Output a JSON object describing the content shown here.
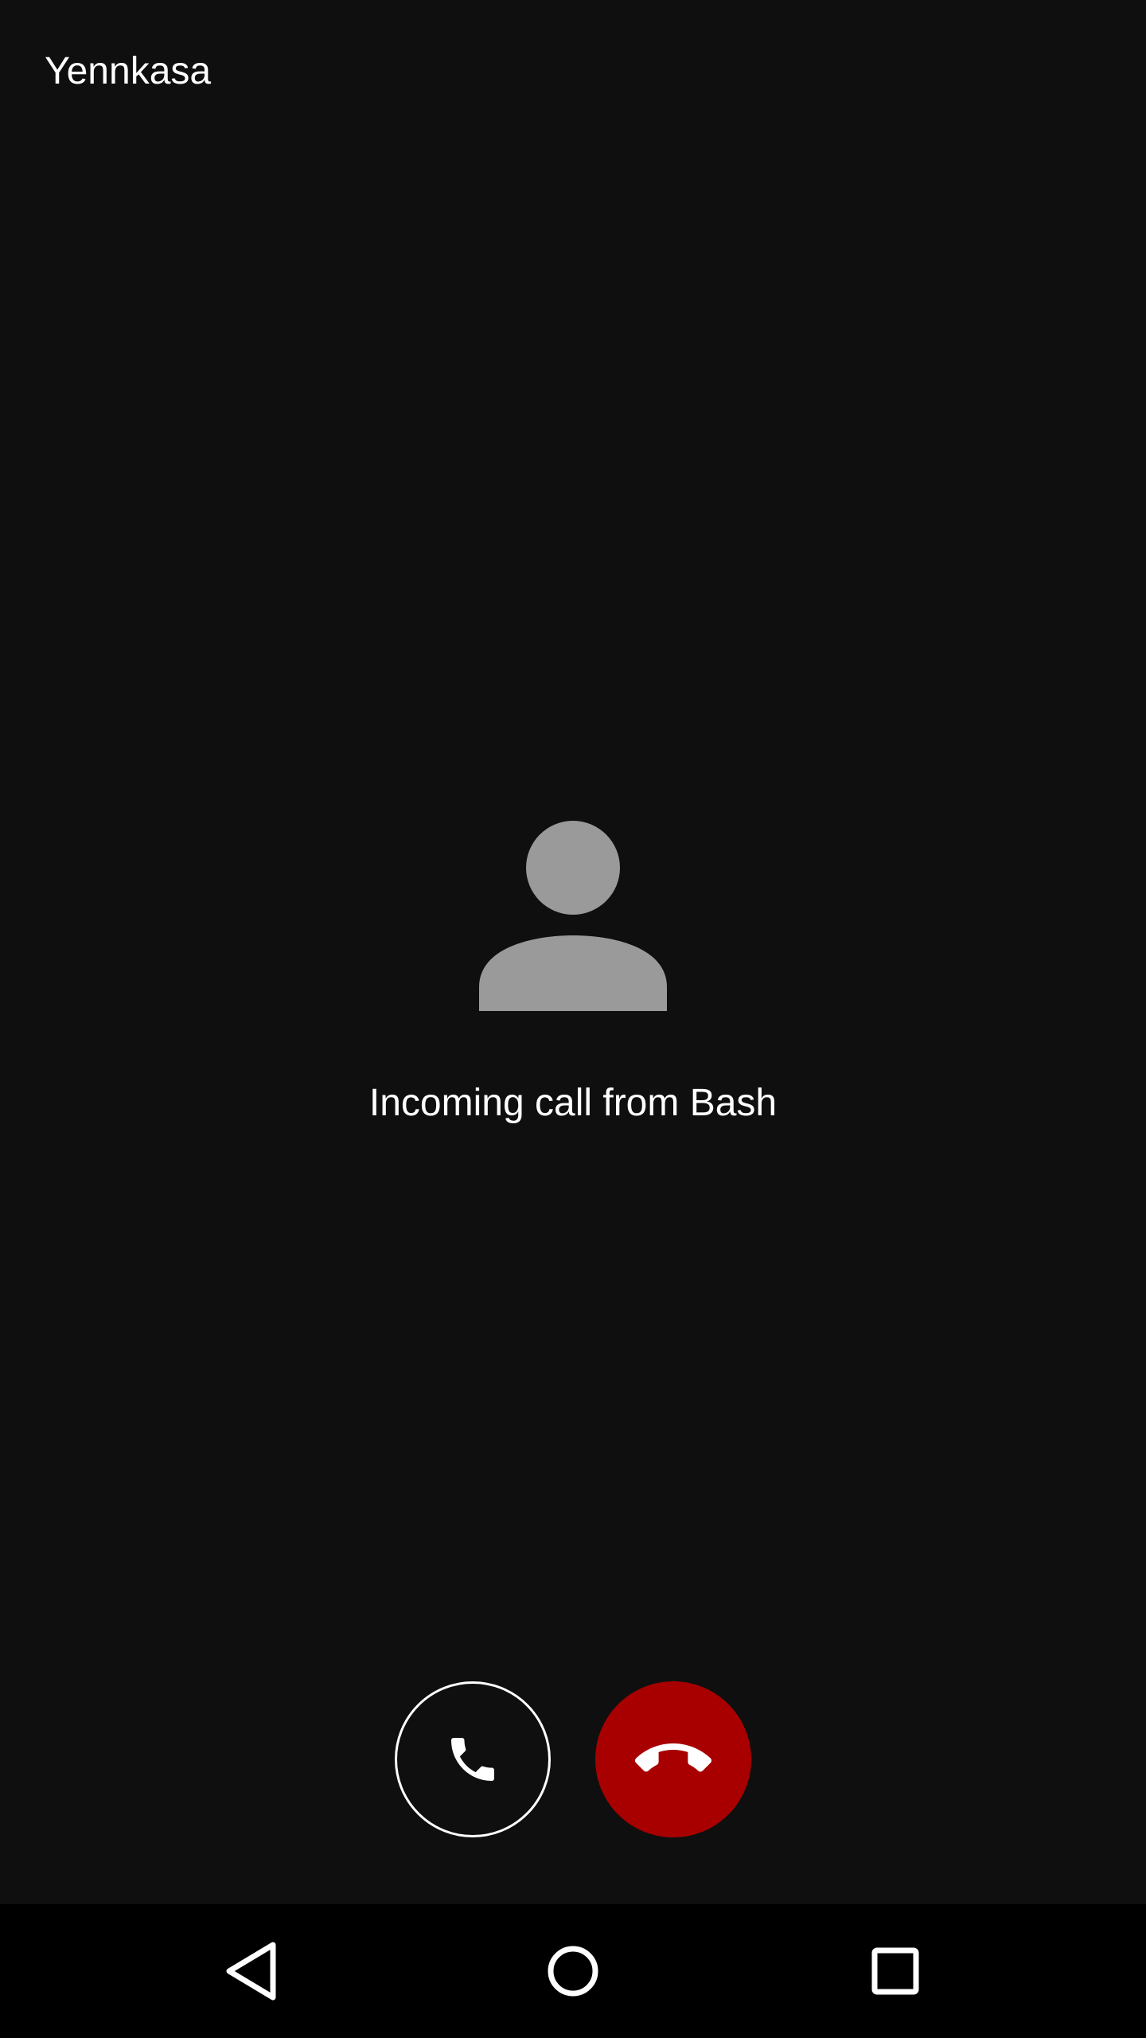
{
  "app": {
    "title": "Yennkasa"
  },
  "call": {
    "status_text": "Incoming call from Bash",
    "avatar_icon": "person-icon",
    "answer_icon": "phone-icon",
    "decline_icon": "phone-hangup-icon",
    "decline_color": "#a80000",
    "answer_border_color": "#ffffff"
  },
  "navigation": {
    "back_icon": "back-triangle-icon",
    "home_icon": "home-circle-icon",
    "recents_icon": "recents-square-icon"
  },
  "colors": {
    "background": "#0f0f0f",
    "nav_background": "#000000",
    "avatar_gray": "#9a9a9a",
    "text": "#ffffff"
  }
}
